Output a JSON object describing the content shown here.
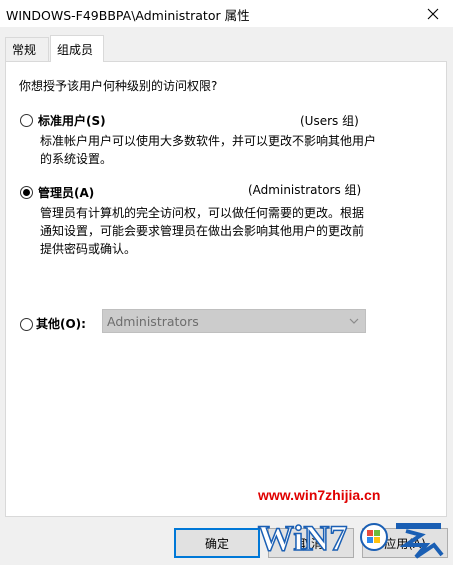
{
  "window": {
    "title": "WINDOWS-F49BBPA\\Administrator 属性"
  },
  "tabs": [
    {
      "label": "常规",
      "active": false
    },
    {
      "label": "组成员",
      "active": true
    }
  ],
  "panel": {
    "question": "你想授予该用户何种级别的访问权限?",
    "options": [
      {
        "label": "标准用户(S)",
        "group": "(Users 组)",
        "description": "标准帐户用户可以使用大多数软件，并可以更改不影响其他用户的系统设置。",
        "checked": false
      },
      {
        "label": "管理员(A)",
        "group": "(Administrators 组)",
        "description": "管理员有计算机的完全访问权，可以做任何需要的更改。根据通知设置，可能会要求管理员在做出会影响其他用户的更改前提供密码或确认。",
        "checked": true
      },
      {
        "label": "其他(O):",
        "checked": false
      }
    ],
    "other_select_value": "Administrators"
  },
  "buttons": {
    "ok": "确定",
    "cancel": "取消",
    "apply": "应用(A)"
  },
  "watermark": {
    "url": "www.win7zhijia.cn"
  },
  "icons": {
    "close": "close-icon",
    "chevron": "chevron-down-icon",
    "logo": "windows-logo-icon"
  }
}
